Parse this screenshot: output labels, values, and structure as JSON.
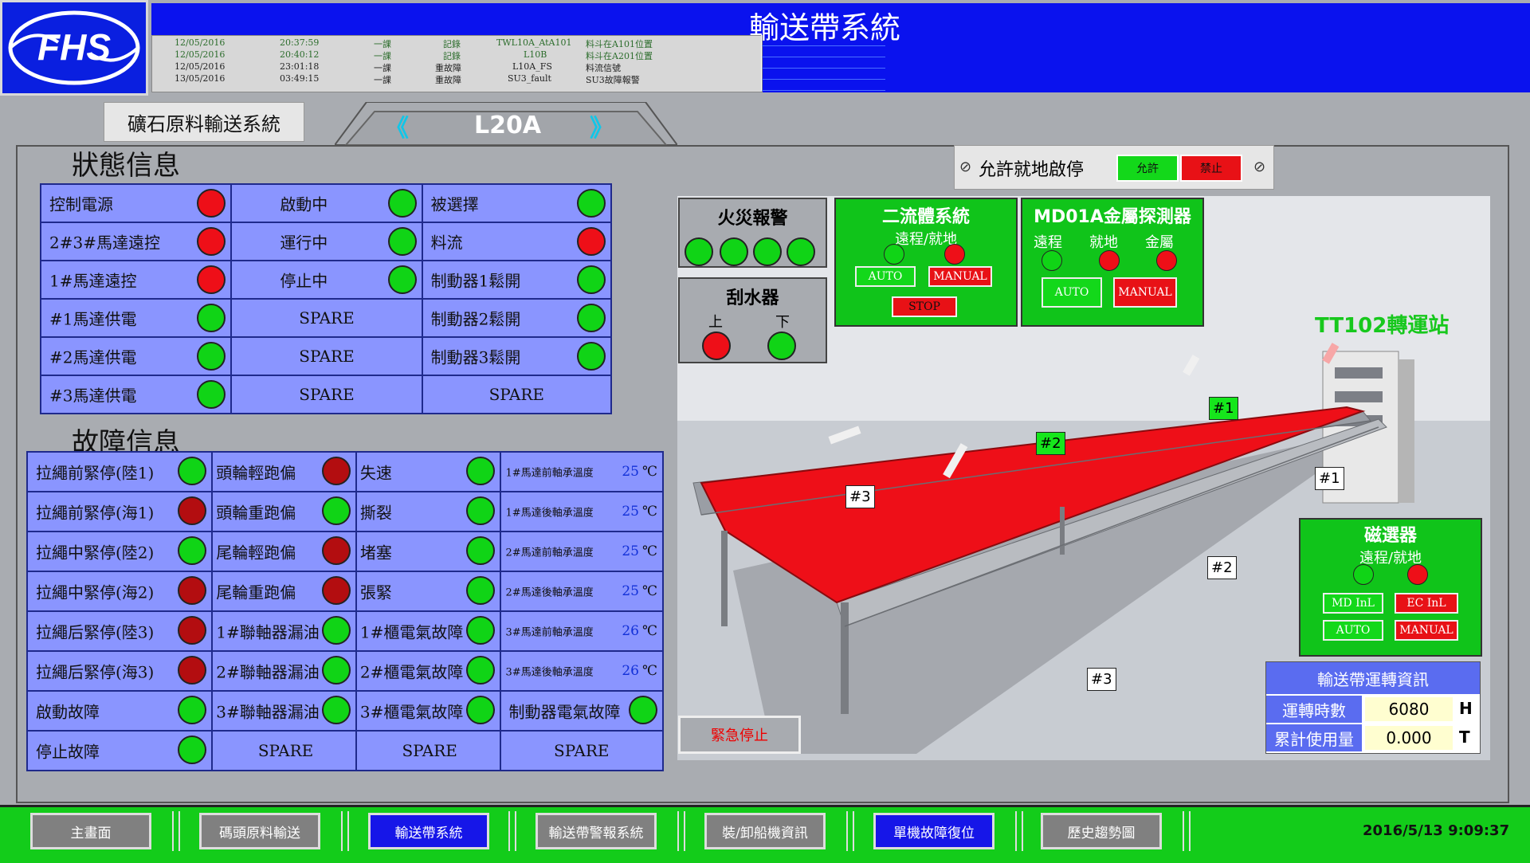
{
  "header": {
    "logo_text": "FHS",
    "title": "輸送帶系統",
    "alarm_rows": [
      {
        "date": "12/05/2016",
        "time": "20:37:59",
        "group": "一課",
        "type": "記錄",
        "tag": "TWL10A_AtA101",
        "desc": "料斗在A101位置"
      },
      {
        "date": "12/05/2016",
        "time": "20:40:12",
        "group": "一課",
        "type": "記錄",
        "tag": "L10B",
        "desc": "料斗在A201位置"
      },
      {
        "date": "12/05/2016",
        "time": "23:01:18",
        "group": "一課",
        "type": "重故障",
        "tag": "L10A_FS",
        "desc": "料流信號"
      },
      {
        "date": "13/05/2016",
        "time": "03:49:15",
        "group": "一課",
        "type": "重故障",
        "tag": "SU3_fault",
        "desc": "SU3故障報警"
      }
    ]
  },
  "subheader": {
    "system_button": "礦石原料輸送系統",
    "line_name": "L20A",
    "prev_symbol": "《",
    "next_symbol": "》"
  },
  "status": {
    "title": "狀態信息",
    "rows": [
      [
        {
          "label": "控制電源",
          "lamp": "red"
        },
        {
          "label": "啟動中",
          "lamp": "green"
        },
        {
          "label": "被選擇",
          "lamp": "green"
        }
      ],
      [
        {
          "label": "2#3#馬達遠控",
          "lamp": "red"
        },
        {
          "label": "運行中",
          "lamp": "green"
        },
        {
          "label": "料流",
          "lamp": "red"
        }
      ],
      [
        {
          "label": "1#馬達遠控",
          "lamp": "red"
        },
        {
          "label": "停止中",
          "lamp": "green"
        },
        {
          "label": "制動器1鬆開",
          "lamp": "green"
        }
      ],
      [
        {
          "label": "#1馬達供電",
          "lamp": "green"
        },
        {
          "label": "SPARE",
          "lamp": ""
        },
        {
          "label": "制動器2鬆開",
          "lamp": "green"
        }
      ],
      [
        {
          "label": "#2馬達供電",
          "lamp": "green"
        },
        {
          "label": "SPARE",
          "lamp": ""
        },
        {
          "label": "制動器3鬆開",
          "lamp": "green"
        }
      ],
      [
        {
          "label": "#3馬達供電",
          "lamp": "green"
        },
        {
          "label": "SPARE",
          "lamp": ""
        },
        {
          "label": "SPARE",
          "lamp": ""
        }
      ]
    ]
  },
  "fault": {
    "title": "故障信息",
    "rows": [
      [
        {
          "label": "拉繩前緊停(陸1)",
          "lamp": "green"
        },
        {
          "label": "頭輪輕跑偏",
          "lamp": "dred"
        },
        {
          "label": "失速",
          "lamp": "green"
        },
        {
          "label": "1#馬達前軸承溫度",
          "value": "25",
          "unit": "℃"
        }
      ],
      [
        {
          "label": "拉繩前緊停(海1)",
          "lamp": "dred"
        },
        {
          "label": "頭輪重跑偏",
          "lamp": "green"
        },
        {
          "label": "撕裂",
          "lamp": "green"
        },
        {
          "label": "1#馬達後軸承溫度",
          "value": "25",
          "unit": "℃"
        }
      ],
      [
        {
          "label": "拉繩中緊停(陸2)",
          "lamp": "green"
        },
        {
          "label": "尾輪輕跑偏",
          "lamp": "dred"
        },
        {
          "label": "堵塞",
          "lamp": "green"
        },
        {
          "label": "2#馬達前軸承溫度",
          "value": "25",
          "unit": "℃"
        }
      ],
      [
        {
          "label": "拉繩中緊停(海2)",
          "lamp": "dred"
        },
        {
          "label": "尾輪重跑偏",
          "lamp": "dred"
        },
        {
          "label": "張緊",
          "lamp": "green"
        },
        {
          "label": "2#馬達後軸承溫度",
          "value": "25",
          "unit": "℃"
        }
      ],
      [
        {
          "label": "拉繩后緊停(陸3)",
          "lamp": "dred"
        },
        {
          "label": "1#聯軸器漏油",
          "lamp": "green"
        },
        {
          "label": "1#櫃電氣故障",
          "lamp": "green"
        },
        {
          "label": "3#馬達前軸承溫度",
          "value": "26",
          "unit": "℃"
        }
      ],
      [
        {
          "label": "拉繩后緊停(海3)",
          "lamp": "dred"
        },
        {
          "label": "2#聯軸器漏油",
          "lamp": "green"
        },
        {
          "label": "2#櫃電氣故障",
          "lamp": "green"
        },
        {
          "label": "3#馬達後軸承溫度",
          "value": "26",
          "unit": "℃"
        }
      ],
      [
        {
          "label": "啟動故障",
          "lamp": "green"
        },
        {
          "label": "3#聯軸器漏油",
          "lamp": "green"
        },
        {
          "label": "3#櫃電氣故障",
          "lamp": "green"
        },
        {
          "label": "制動器電氣故障",
          "lamp": "green"
        }
      ],
      [
        {
          "label": "停止故障",
          "lamp": "green"
        },
        {
          "label": "SPARE",
          "lamp": ""
        },
        {
          "label": "SPARE",
          "lamp": ""
        },
        {
          "label": "SPARE",
          "lamp": ""
        }
      ]
    ]
  },
  "local_stop": {
    "label": "允許就地啟停",
    "allow": "允許",
    "deny": "禁止"
  },
  "fire_alarm": {
    "title": "火災報警"
  },
  "scraper": {
    "title": "刮水器",
    "up": "上",
    "down": "下"
  },
  "flow_system": {
    "title": "二流體系統",
    "mode": "遠程/就地",
    "auto": "AUTO",
    "manual": "MANUAL",
    "stop": "STOP"
  },
  "metal_detector": {
    "title": "MD01A金屬探測器",
    "remote": "遠程",
    "local": "就地",
    "metal": "金屬",
    "auto": "AUTO",
    "manual": "MANUAL"
  },
  "station_label": "TT102轉運站",
  "magnet": {
    "title": "磁選器",
    "mode": "遠程/就地",
    "md_inl": "MD InL",
    "ec_inl": "EC InL",
    "auto": "AUTO",
    "manual": "MANUAL"
  },
  "markers": {
    "g1": "#1",
    "g2": "#2",
    "w3a": "#3",
    "w1": "#1",
    "w2": "#2",
    "w3b": "#3"
  },
  "runtime": {
    "title": "輸送帶運轉資訊",
    "hours_label": "運轉時數",
    "hours_value": "6080",
    "hours_unit": "H",
    "usage_label": "累計使用量",
    "usage_value": "0.000",
    "usage_unit": "T"
  },
  "emergency": "緊急停止",
  "nav": {
    "items": [
      "主畫面",
      "碼頭原料輸送",
      "輸送帶系統",
      "輸送帶警報系統",
      "裝/卸船機資訊",
      "單機故障復位",
      "歷史趨勢圖"
    ],
    "clock": "2016/5/13 9:09:37"
  },
  "colors": {
    "accent_blue": "#0a12ee",
    "lamp_green": "#10d416",
    "lamp_red": "#ee0f18",
    "panel_green": "#10c41a",
    "table_blue": "#8a95ff"
  }
}
